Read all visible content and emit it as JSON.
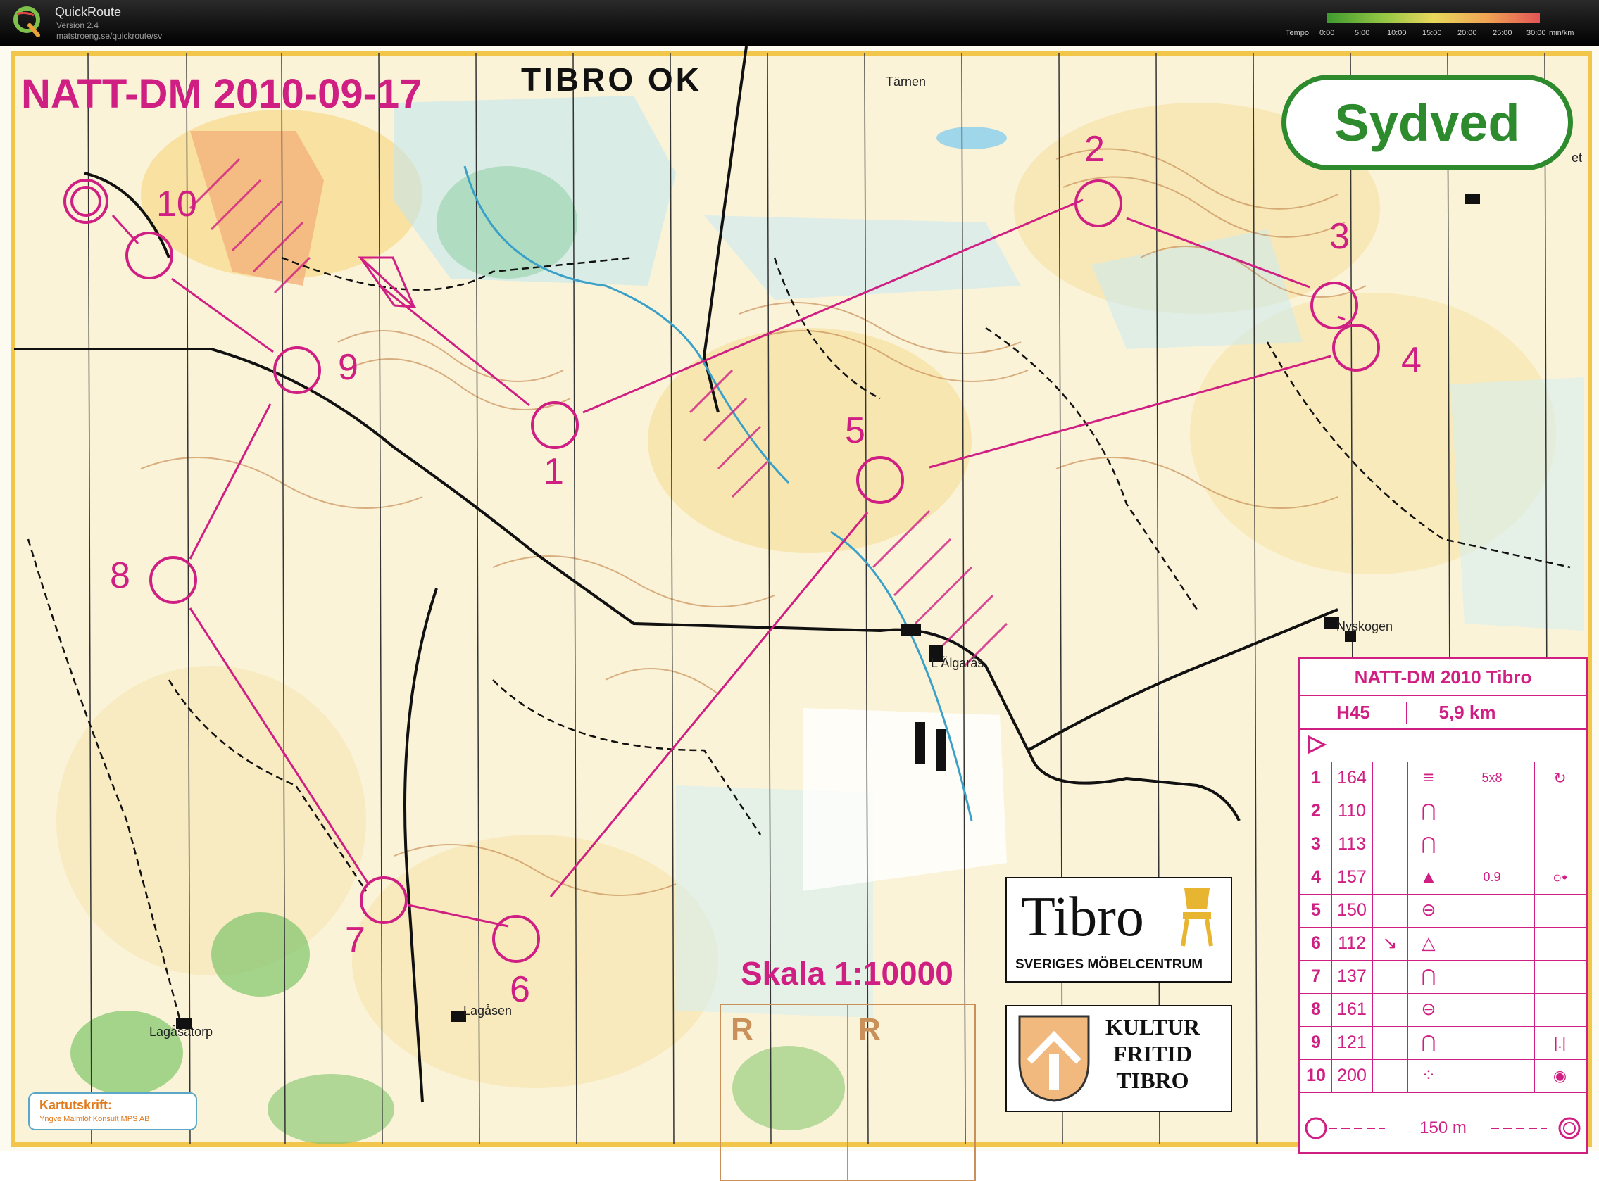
{
  "app": {
    "name": "QuickRoute",
    "version": "Version 2.4",
    "url": "matstroeng.se/quickroute/sv"
  },
  "tempo": {
    "label": "Tempo",
    "ticks": [
      "0:00",
      "5:00",
      "10:00",
      "15:00",
      "20:00",
      "25:00",
      "30:00"
    ],
    "unit": "min/km"
  },
  "map": {
    "title": "NATT-DM 2010-09-17",
    "club_logo": "TIBRO OK",
    "sponsor_logo": "Sydved",
    "scale": "Skala 1:10000",
    "places": [
      "Tärnen",
      "L Älgarås",
      "Nyskogen",
      "Lagåsen",
      "Lagåsatorp",
      "et"
    ],
    "controls": [
      "1",
      "2",
      "3",
      "4",
      "5",
      "6",
      "7",
      "8",
      "9",
      "10"
    ],
    "refreshment": [
      "R",
      "R"
    ],
    "tibro_logo": {
      "word": "Tibro",
      "sub": "SVERIGES MÖBELCENTRUM"
    },
    "kultur_logo": [
      "KULTUR",
      "FRITID",
      "TIBRO"
    ],
    "credit": {
      "title": "Kartutskrift:",
      "sub": "Yngve Malmlöf Konsult MPS AB"
    },
    "colors": {
      "course": "#d01f83",
      "contour": "#c9905a",
      "forest": "#7fc46a",
      "water": "#9fd6ea",
      "open": "#f6d98a"
    }
  },
  "description": {
    "title": "NATT-DM 2010 Tibro",
    "class": "H45",
    "distance": "5,9 km",
    "rows": [
      {
        "num": "1",
        "code": "164",
        "c3": "",
        "feature": "≡",
        "dim": "5x8",
        "extra": "↻"
      },
      {
        "num": "2",
        "code": "110",
        "c3": "",
        "feature": "⋂",
        "dim": "",
        "extra": ""
      },
      {
        "num": "3",
        "code": "113",
        "c3": "",
        "feature": "⋂",
        "dim": "",
        "extra": ""
      },
      {
        "num": "4",
        "code": "157",
        "c3": "",
        "feature": "▲",
        "dim": "0.9",
        "extra": "○•"
      },
      {
        "num": "5",
        "code": "150",
        "c3": "",
        "feature": "⊖",
        "dim": "",
        "extra": ""
      },
      {
        "num": "6",
        "code": "112",
        "c3": "↘",
        "feature": "△",
        "dim": "",
        "extra": ""
      },
      {
        "num": "7",
        "code": "137",
        "c3": "",
        "feature": "⋂",
        "dim": "",
        "extra": ""
      },
      {
        "num": "8",
        "code": "161",
        "c3": "",
        "feature": "⊖",
        "dim": "",
        "extra": ""
      },
      {
        "num": "9",
        "code": "121",
        "c3": "",
        "feature": "⋂",
        "dim": "",
        "extra": "|.|"
      },
      {
        "num": "10",
        "code": "200",
        "c3": "",
        "feature": "⁘",
        "dim": "",
        "extra": "◉"
      }
    ],
    "finish": "150 m"
  }
}
